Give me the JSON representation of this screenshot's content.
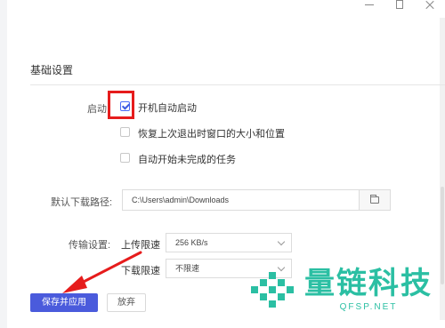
{
  "window": {
    "controls": [
      "minimize",
      "maximize",
      "close"
    ]
  },
  "section": {
    "title": "基础设置"
  },
  "startup": {
    "label": "启动:",
    "options": [
      {
        "text": "开机自动启动",
        "checked": true
      },
      {
        "text": "恢复上次退出时窗口的大小和位置",
        "checked": false
      },
      {
        "text": "自动开始未完成的任务",
        "checked": false
      }
    ]
  },
  "download_path": {
    "label": "默认下载路径:",
    "value": "C:\\Users\\admin\\Downloads",
    "browse_icon": "folder-icon"
  },
  "transfer": {
    "label": "传输设置:",
    "upload_label": "上传限速",
    "upload_value": "256 KB/s",
    "download_label": "下载限速",
    "download_value": "不限速"
  },
  "buttons": {
    "save": "保存并应用",
    "cancel": "放弃"
  },
  "annotation": {
    "highlight_color": "#e61c1c",
    "arrow_color": "#e61c1c"
  },
  "watermark": {
    "title": "量链科技",
    "subtitle": "QFSP.NET",
    "color": "#2bbfa3"
  },
  "colors": {
    "accent": "#4a5bdc"
  }
}
